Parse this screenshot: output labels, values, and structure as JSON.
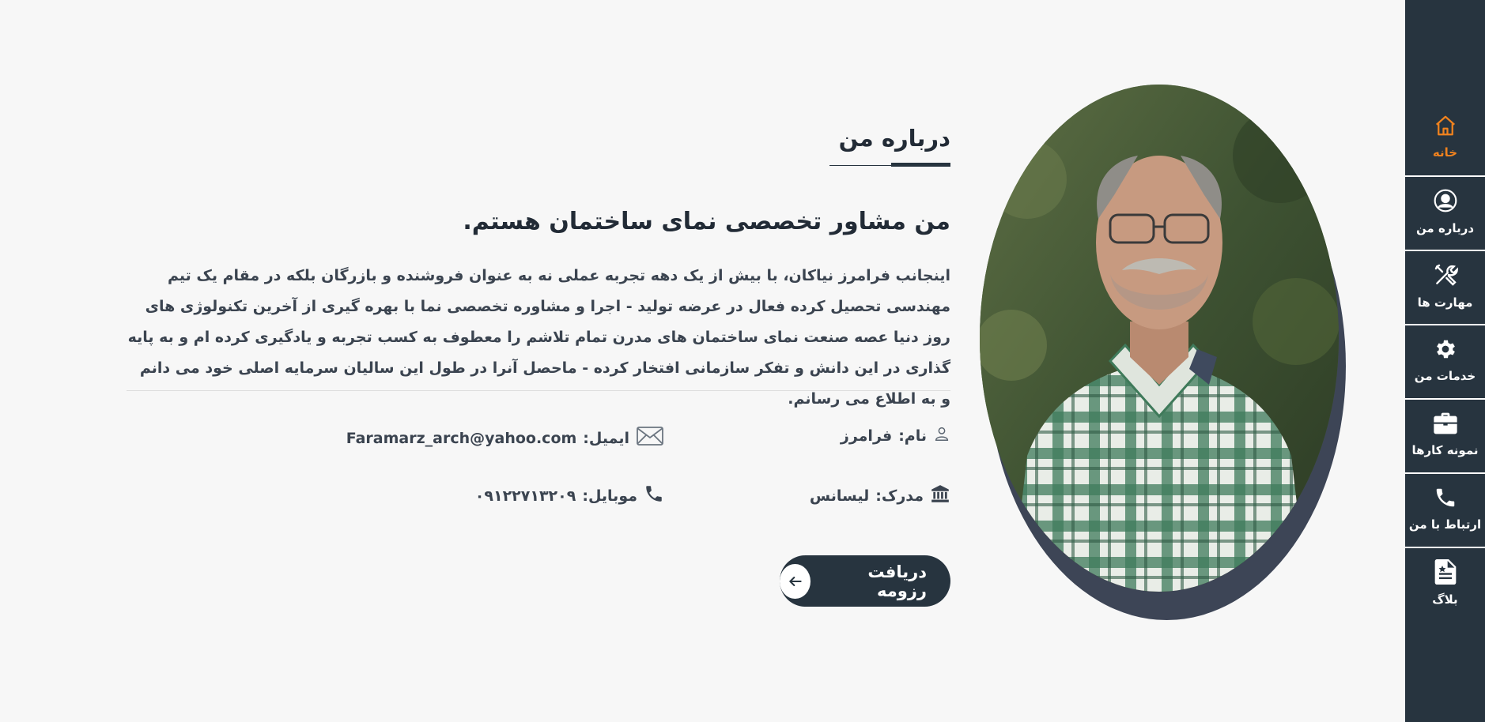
{
  "sidebar": {
    "items": [
      {
        "label": "خانه",
        "icon": "home-icon",
        "active": true
      },
      {
        "label": "درباره من",
        "icon": "user-circle-icon"
      },
      {
        "label": "مهارت ها",
        "icon": "tools-icon"
      },
      {
        "label": "خدمات من",
        "icon": "gear-icon"
      },
      {
        "label": "نمونه کارها",
        "icon": "briefcase-icon"
      },
      {
        "label": "ارتباط با من",
        "icon": "phone-icon"
      },
      {
        "label": "بلاگ",
        "icon": "document-icon"
      }
    ]
  },
  "about": {
    "section_title": "درباره من",
    "heading": "من مشاور تخصصی نمای ساختمان هستم.",
    "paragraph": "اینجانب فرامرز نیاکان، با بیش از یک دهه تجربه عملی نه به عنوان فروشنده و بازرگان بلکه در مقام یک تیم مهندسی تحصیل کرده فعال در عرضه تولید - اجرا و مشاوره تخصصی نما با بهره گیری از آخرین تکنولوژی های روز دنیا عصه صنعت نمای ساختمان های مدرن تمام تلاشم را معطوف به کسب تجربه و یادگیری کرده ام و به پایه گذاری در این دانش و تفکر سازمانی افتخار کرده - ماحصل آنرا در طول این سالیان سرمایه اصلی خود می دانم و به اطلاع می رسانم.",
    "info": {
      "name_label": "نام:",
      "name_value": "فرامرز",
      "email_label": "ایمیل:",
      "email_value": "Faramarz_arch@yahoo.com",
      "degree_label": "مدرک:",
      "degree_value": "لیسانس",
      "mobile_label": "موبایل:",
      "mobile_value": "۰۹۱۲۲۷۱۳۲۰۹"
    },
    "resume_button": "دریافت رزومه"
  },
  "colors": {
    "sidebar_bg": "#27343f",
    "accent": "#f0821e",
    "page_bg": "#f7f7f7"
  }
}
